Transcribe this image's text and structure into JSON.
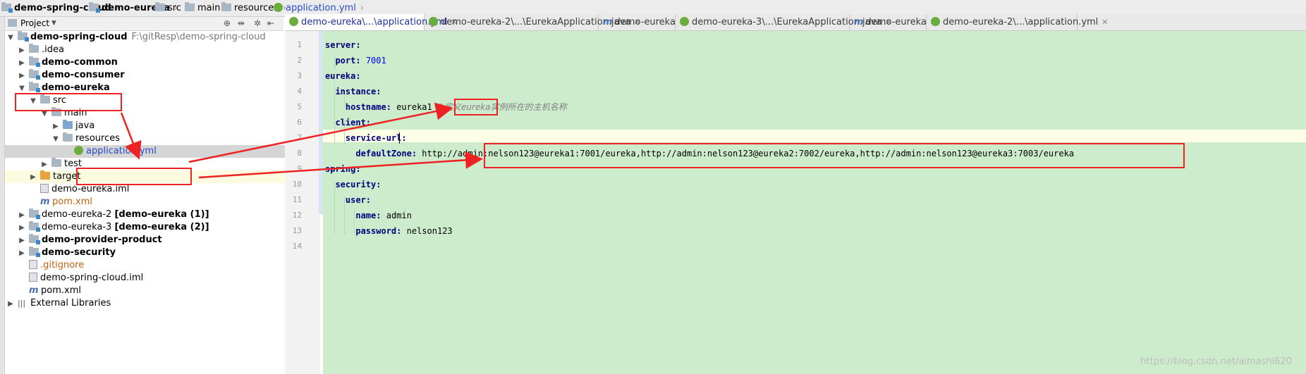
{
  "breadcrumbs": [
    "demo-spring-cloud",
    "demo-eureka",
    "src",
    "main",
    "resources",
    "application.yml"
  ],
  "project_panel": {
    "title": "Project",
    "root_name": "demo-spring-cloud",
    "root_path": "F:\\gitResp\\demo-spring-cloud",
    "items": [
      {
        "label": "demo-spring-cloud",
        "path": "F:\\gitResp\\demo-spring-cloud"
      },
      {
        "label": ".idea"
      },
      {
        "label": "demo-common"
      },
      {
        "label": "demo-consumer"
      },
      {
        "label": "demo-eureka"
      },
      {
        "label": "src"
      },
      {
        "label": "main"
      },
      {
        "label": "java"
      },
      {
        "label": "resources"
      },
      {
        "label": "application.yml"
      },
      {
        "label": "test"
      },
      {
        "label": "target"
      },
      {
        "label": "demo-eureka.iml"
      },
      {
        "label": "pom.xml"
      },
      {
        "label": "demo-eureka-2",
        "suffix": "[demo-eureka (1)]"
      },
      {
        "label": "demo-eureka-3",
        "suffix": "[demo-eureka (2)]"
      },
      {
        "label": "demo-provider-product"
      },
      {
        "label": "demo-security"
      },
      {
        "label": ".gitignore"
      },
      {
        "label": "demo-spring-cloud.iml"
      },
      {
        "label": "pom.xml"
      },
      {
        "label": "External Libraries"
      }
    ]
  },
  "tabs": [
    {
      "label": "demo-eureka\\...\\application.yml",
      "active": true
    },
    {
      "label": "demo-eureka-2\\...\\EurekaApplication.java"
    },
    {
      "label": "demo-eureka"
    },
    {
      "label": "demo-eureka-3\\...\\EurekaApplication.java"
    },
    {
      "label": "demo-eureka"
    },
    {
      "label": "demo-eureka-2\\...\\application.yml"
    }
  ],
  "editor": {
    "line_numbers": [
      "1",
      "2",
      "3",
      "4",
      "5",
      "6",
      "7",
      "8",
      "9",
      "10",
      "11",
      "12",
      "13",
      "14"
    ],
    "lines": {
      "l1_key": "server:",
      "l2_key": "port:",
      "l2_val": "7001",
      "l3_key": "eureka:",
      "l4_key": "instance:",
      "l5_key": "hostname:",
      "l5_val": "eureka1",
      "l5_cmt": "#定义eureka实例所在的主机名称",
      "l6_key": "client:",
      "l7_key": "service-url:",
      "l8_key": "defaultZone:",
      "l8_val": "http://admin:nelson123@eureka1:7001/eureka,http://admin:nelson123@eureka2:7002/eureka,http://admin:nelson123@eureka3:7003/eureka",
      "l9_key": "spring:",
      "l10_key": "security:",
      "l11_key": "user:",
      "l12_key": "name:",
      "l12_val": "admin",
      "l13_key": "password:",
      "l13_val": "nelson123"
    }
  },
  "watermark": "https://blog.csdn.net/aimashi620",
  "colors": {
    "editor_bg": "#cdeccb",
    "annotation_red": "#e22222",
    "yaml_key": "#000080"
  }
}
